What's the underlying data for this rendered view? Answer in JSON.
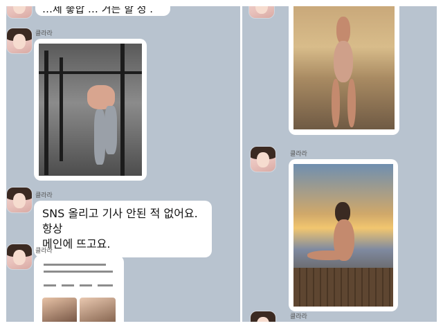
{
  "left_panel": {
    "top_message_fragment": "…제 좋합 … 거든 할 정 .",
    "sender_name": "클라라",
    "text_message": "SNS 올리고 기사 안된 적 없어요. 항상\n메인에 뜨고요.",
    "images": [
      "gym-photo",
      "news-snippet"
    ]
  },
  "right_panel": {
    "sender_name": "클라라",
    "images": [
      "beach-photo-standing",
      "beach-photo-sunset-dock"
    ]
  },
  "colors": {
    "chat_background": "#b8c3cf",
    "bubble": "#ffffff",
    "divider": "#ffffff"
  }
}
